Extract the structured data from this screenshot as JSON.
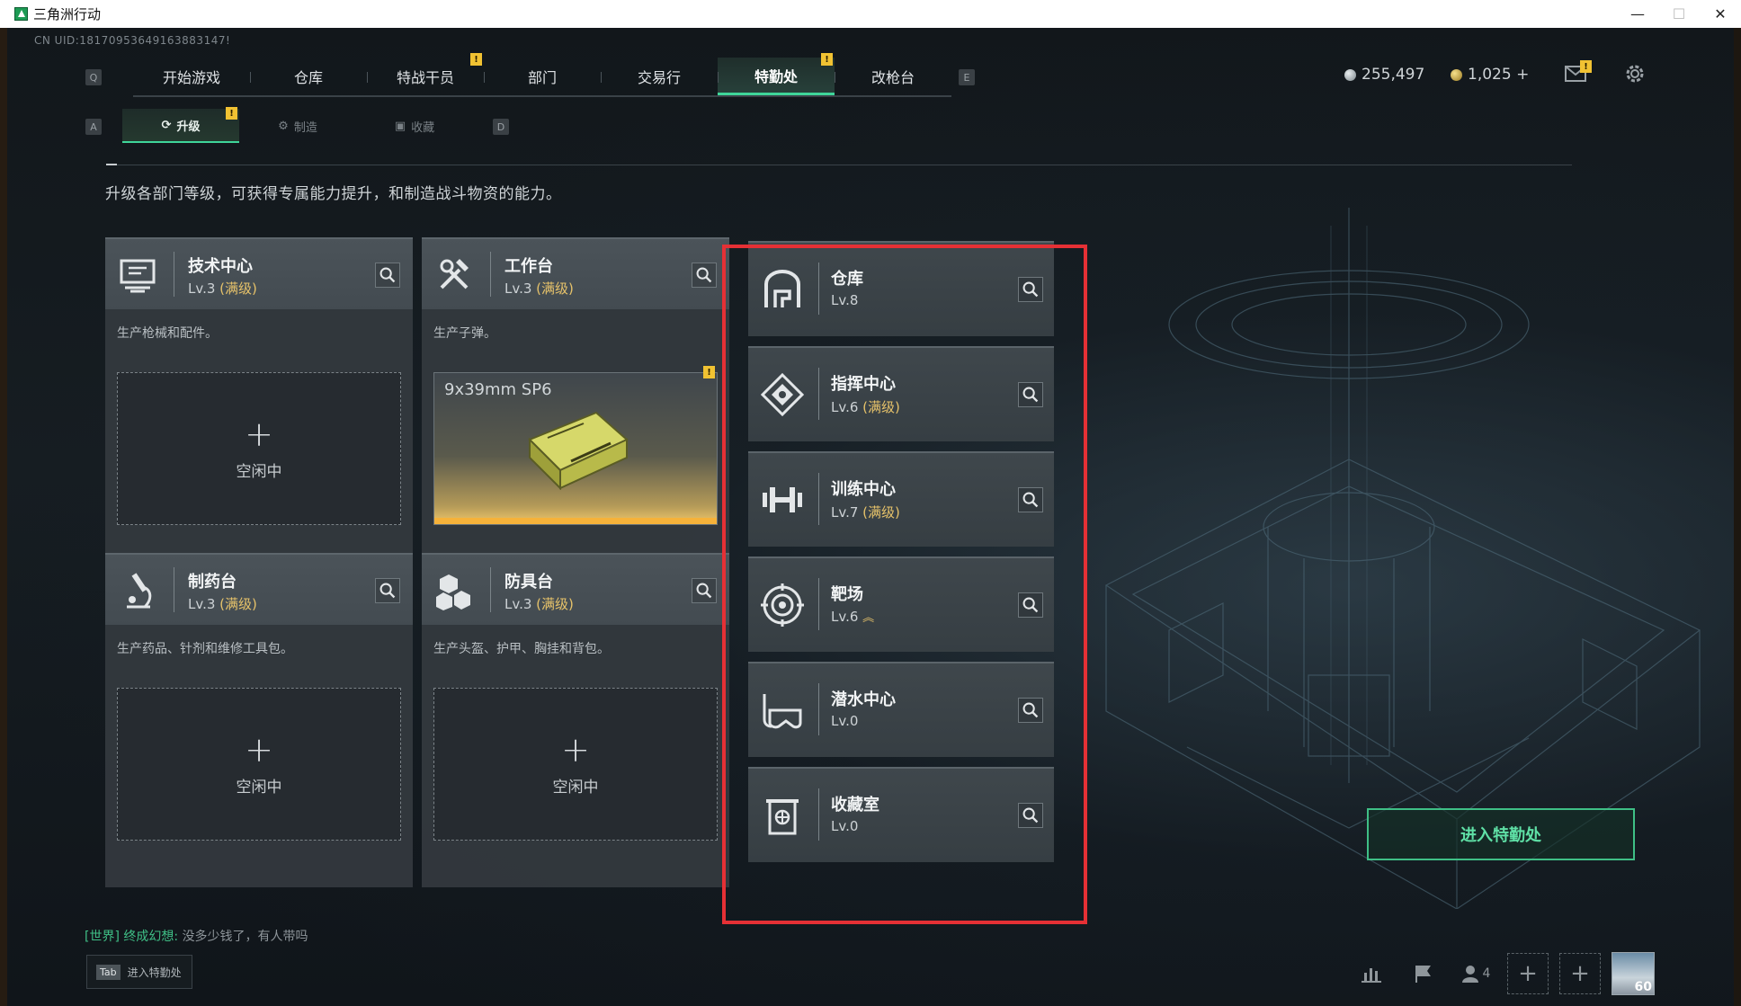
{
  "window": {
    "title": "三角洲行动",
    "controls": [
      "—",
      "☐",
      "✕"
    ]
  },
  "uid": "CN UID:18170953649163883147!",
  "key_hints": {
    "prev_tab": "Q",
    "next_tab": "E",
    "sub_prev": "A",
    "sub_next": "D"
  },
  "main_nav": [
    {
      "label": "开始游戏",
      "active": false,
      "alert": false
    },
    {
      "label": "仓库",
      "active": false,
      "alert": false
    },
    {
      "label": "特战干员",
      "active": false,
      "alert": true
    },
    {
      "label": "部门",
      "active": false,
      "alert": false
    },
    {
      "label": "交易行",
      "active": false,
      "alert": false
    },
    {
      "label": "特勤处",
      "active": true,
      "alert": true
    },
    {
      "label": "改枪台",
      "active": false,
      "alert": false
    }
  ],
  "currency": {
    "silver": "255,497",
    "gold": "1,025 +"
  },
  "alert_mark": "!",
  "sub_nav": [
    {
      "label": "升级",
      "active": true,
      "icon": "upgrade-icon"
    },
    {
      "label": "制造",
      "active": false,
      "icon": "craft-icon"
    },
    {
      "label": "收藏",
      "active": false,
      "icon": "collection-icon"
    }
  ],
  "intro": "升级各部门等级，可获得专属能力提升，和制造战斗物资的能力。",
  "stations": [
    {
      "name": "技术中心",
      "level": "Lv.3",
      "max": "(满级)",
      "desc": "生产枪械和配件。",
      "status": "空闲中",
      "icon": "monitor-icon"
    },
    {
      "name": "工作台",
      "level": "Lv.3",
      "max": "(满级)",
      "desc": "生产子弹。",
      "producing": "9x39mm SP6",
      "icon": "tools-icon"
    },
    {
      "name": "制药台",
      "level": "Lv.3",
      "max": "(满级)",
      "desc": "生产药品、针剂和维修工具包。",
      "status": "空闲中",
      "icon": "microscope-icon"
    },
    {
      "name": "防具台",
      "level": "Lv.3",
      "max": "(满级)",
      "desc": "生产头盔、护甲、胸挂和背包。",
      "status": "空闲中",
      "icon": "armor-icon"
    }
  ],
  "plus_sign": "+",
  "facilities": [
    {
      "name": "仓库",
      "level": "Lv.8",
      "max": "",
      "icon": "warehouse-icon"
    },
    {
      "name": "指挥中心",
      "level": "Lv.6",
      "max": "(满级)",
      "icon": "command-icon"
    },
    {
      "name": "训练中心",
      "level": "Lv.7",
      "max": "(满级)",
      "icon": "dumbbell-icon"
    },
    {
      "name": "靶场",
      "level": "Lv.6",
      "max": "",
      "upgrade": "︽",
      "icon": "target-icon"
    },
    {
      "name": "潜水中心",
      "level": "Lv.0",
      "max": "",
      "icon": "diving-mask-icon"
    },
    {
      "name": "收藏室",
      "level": "Lv.0",
      "max": "",
      "icon": "collection-room-icon"
    }
  ],
  "enter_button": "进入特勤处",
  "chat": {
    "channel": "[世界]",
    "user": "终成幻想:",
    "message": "没多少钱了，有人带吗"
  },
  "tab_hint": {
    "key": "Tab",
    "label": "进入特勤处"
  },
  "bottom_bar": {
    "squad_count": "4",
    "player_level": "60"
  },
  "colors": {
    "accent": "#3fd69a",
    "max_level": "#e6c26a",
    "highlight_box": "#e53035",
    "alert": "#f1c232"
  }
}
